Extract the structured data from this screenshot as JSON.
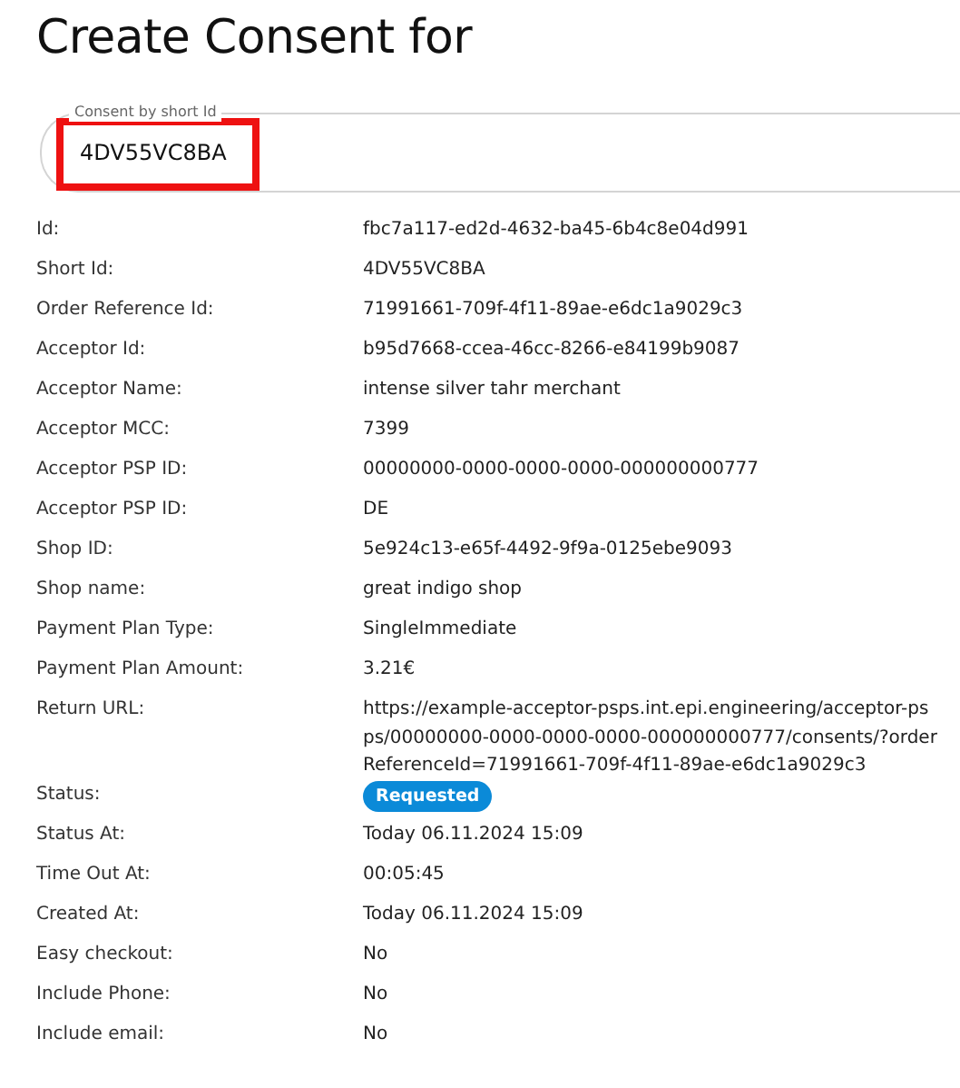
{
  "title": "Create Consent for",
  "search": {
    "label": "Consent by short Id",
    "value": "4DV55VC8BA",
    "highlighted": true
  },
  "details": [
    {
      "label": "Id:",
      "value": "fbc7a117-ed2d-4632-ba45-6b4c8e04d991",
      "kind": "text"
    },
    {
      "label": "Short Id:",
      "value": "4DV55VC8BA",
      "kind": "text"
    },
    {
      "label": "Order Reference Id:",
      "value": "71991661-709f-4f11-89ae-e6dc1a9029c3",
      "kind": "text"
    },
    {
      "label": "Acceptor Id:",
      "value": "b95d7668-ccea-46cc-8266-e84199b9087",
      "kind": "text"
    },
    {
      "label": "Acceptor Name:",
      "value": "intense silver tahr merchant",
      "kind": "text"
    },
    {
      "label": "Acceptor MCC:",
      "value": "7399",
      "kind": "text"
    },
    {
      "label": "Acceptor PSP ID:",
      "value": "00000000-0000-0000-0000-000000000777",
      "kind": "text"
    },
    {
      "label": "Acceptor PSP ID:",
      "value": "DE",
      "kind": "text"
    },
    {
      "label": "Shop ID:",
      "value": "5e924c13-e65f-4492-9f9a-0125ebe9093",
      "kind": "text"
    },
    {
      "label": "Shop name:",
      "value": "great indigo shop",
      "kind": "text"
    },
    {
      "label": "Payment Plan Type:",
      "value": "SingleImmediate",
      "kind": "text"
    },
    {
      "label": "Payment Plan Amount:",
      "value": "3.21€",
      "kind": "text"
    },
    {
      "label": "Return URL:",
      "value": "https://example-acceptor-psps.int.epi.engineering/acceptor-psps/00000000-0000-0000-0000-000000000777/consents/?orderReferenceId=71991661-709f-4f11-89ae-e6dc1a9029c3",
      "kind": "text"
    },
    {
      "label": "Status:",
      "value": "Requested",
      "kind": "badge",
      "color": "#0b8ad8"
    },
    {
      "label": "Status At:",
      "value": "Today 06.11.2024 15:09",
      "kind": "text"
    },
    {
      "label": "Time Out At:",
      "value": "00:05:45",
      "kind": "text"
    },
    {
      "label": "Created At:",
      "value": "Today 06.11.2024 15:09",
      "kind": "text"
    },
    {
      "label": "Easy checkout:",
      "value": "No",
      "kind": "text"
    },
    {
      "label": "Include Phone:",
      "value": "No",
      "kind": "text"
    },
    {
      "label": "Include email:",
      "value": "No",
      "kind": "text"
    }
  ]
}
